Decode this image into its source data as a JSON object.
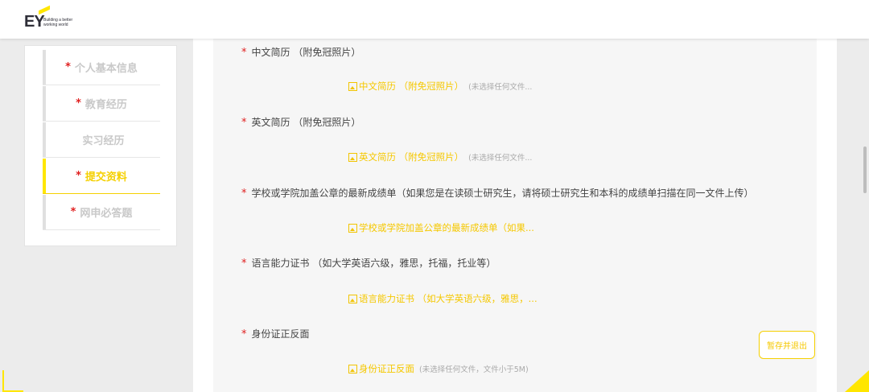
{
  "header": {
    "logo_text": "EY",
    "logo_tagline": "Building a better working world"
  },
  "sidebar": {
    "items": [
      {
        "label": "个人基本信息",
        "required": "*"
      },
      {
        "label": "教育经历",
        "required": "*"
      },
      {
        "label": "实习经历",
        "required": ""
      },
      {
        "label": "提交资料",
        "required": "*"
      },
      {
        "label": "网申必答题",
        "required": "*"
      }
    ],
    "active_index": 3
  },
  "form": {
    "fields": [
      {
        "label": "中文简历 （附免冠照片）",
        "upload_label": "中文简历 （附免冠照片）",
        "upload_hint": "(未选择任何文件..."
      },
      {
        "label": "英文简历 （附免冠照片）",
        "upload_label": "英文简历 （附免冠照片）",
        "upload_hint": "(未选择任何文件..."
      },
      {
        "label": "学校或学院加盖公章的最新成绩单（如果您是在读硕士研究生，请将硕士研究生和本科的成绩单扫描在同一文件上传）",
        "upload_label": "学校或学院加盖公章的最新成绩单（如果...",
        "upload_hint": ""
      },
      {
        "label": "语言能力证书 （如大学英语六级，雅思，托福，托业等）",
        "upload_label": "语言能力证书 （如大学英语六级，雅思，...",
        "upload_hint": ""
      },
      {
        "label": "身份证正反面",
        "upload_label": "身份证正反面",
        "upload_hint": "(未选择任何文件，文件小于5M)"
      }
    ]
  },
  "actions": {
    "save_exit_label": "暂存并退出"
  },
  "colors": {
    "accent": "#ffe600",
    "accent_text": "#f5c800",
    "required": "#e02020"
  }
}
